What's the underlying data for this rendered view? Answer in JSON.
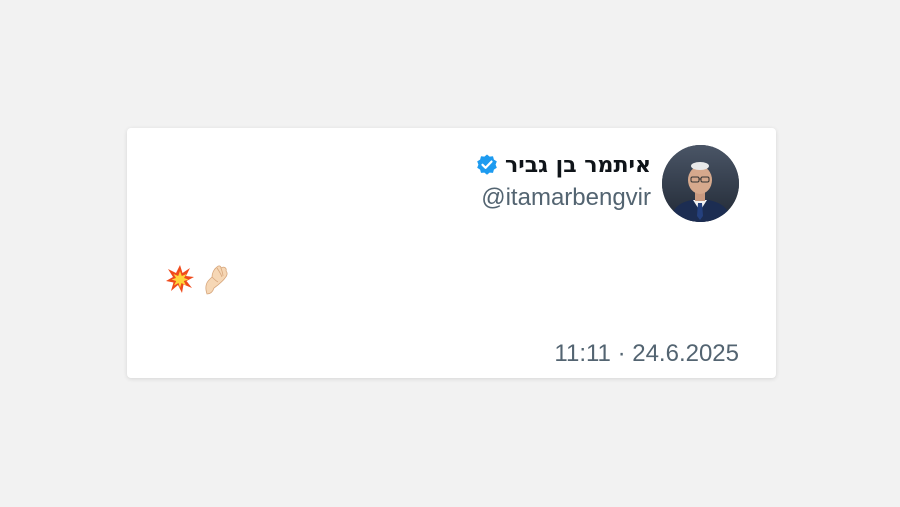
{
  "tweet": {
    "author": {
      "display_name": "איתמר בן גביר",
      "handle": "@itamarbengvir",
      "verified": true,
      "verified_icon": "verified-badge-icon"
    },
    "body_emojis": [
      "collision-emoji",
      "pinched-fingers-emoji"
    ],
    "timestamp": "11:11 · 24.6.2025"
  },
  "colors": {
    "background": "#f2f2f2",
    "card": "#ffffff",
    "name_text": "#0f1419",
    "secondary_text": "#536471",
    "verified_blue": "#1d9bf0"
  }
}
